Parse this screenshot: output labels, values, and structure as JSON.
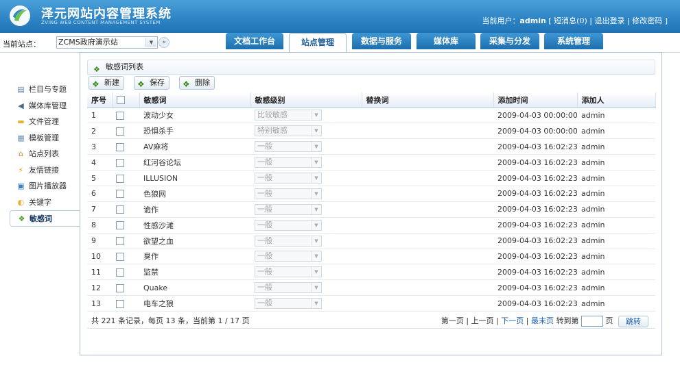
{
  "header": {
    "title": "泽元网站内容管理系统",
    "subtitle": "ZVING WEB CONTENT MANAGEMENT SYSTEM",
    "user_prefix": "当前用户：",
    "user_name": "admin",
    "bracket_open": "[",
    "messages": "短消息(0)",
    "logout": "退出登录",
    "change_password": "修改密码",
    "bracket_close": "]",
    "sep": "|"
  },
  "site": {
    "label": "当前站点：",
    "value": "ZCMS政府演示站",
    "collapse": "«"
  },
  "tabs": [
    {
      "label": "文档工作台"
    },
    {
      "label": "站点管理"
    },
    {
      "label": "数据与服务"
    },
    {
      "label": "媒体库"
    },
    {
      "label": "采集与分发"
    },
    {
      "label": "系统管理"
    }
  ],
  "sidebar": {
    "items": [
      {
        "label": "栏目与专题",
        "icon": "column-icon"
      },
      {
        "label": "媒体库管理",
        "icon": "media-icon"
      },
      {
        "label": "文件管理",
        "icon": "folder-icon"
      },
      {
        "label": "模板管理",
        "icon": "template-icon"
      },
      {
        "label": "站点列表",
        "icon": "home-icon"
      },
      {
        "label": "友情链接",
        "icon": "link-icon"
      },
      {
        "label": "图片播放器",
        "icon": "image-player-icon"
      },
      {
        "label": "关键字",
        "icon": "keyword-icon"
      },
      {
        "label": "敏感词",
        "icon": "sensitive-word-icon"
      }
    ]
  },
  "panel": {
    "title": "敏感词列表",
    "buttons": {
      "new": "新建",
      "save": "保存",
      "delete": "删除"
    }
  },
  "table": {
    "columns": [
      "序号",
      "",
      "敏感词",
      "敏感级别",
      "替换词",
      "添加时间",
      "添加人"
    ],
    "rows": [
      {
        "no": "1",
        "word": "波动少女",
        "level": "比较敏感",
        "replace": "",
        "time": "2009-04-03 00:00:00",
        "user": "admin"
      },
      {
        "no": "2",
        "word": "恐惧杀手",
        "level": "特别敏感",
        "replace": "",
        "time": "2009-04-03 00:00:00",
        "user": "admin"
      },
      {
        "no": "3",
        "word": "AV麻将",
        "level": "一般",
        "replace": "",
        "time": "2009-04-03 16:02:23",
        "user": "admin"
      },
      {
        "no": "4",
        "word": "红河谷论坛",
        "level": "一般",
        "replace": "",
        "time": "2009-04-03 16:02:23",
        "user": "admin"
      },
      {
        "no": "5",
        "word": "ILLUSION",
        "level": "一般",
        "replace": "",
        "time": "2009-04-03 16:02:23",
        "user": "admin"
      },
      {
        "no": "6",
        "word": "色狼网",
        "level": "一般",
        "replace": "",
        "time": "2009-04-03 16:02:23",
        "user": "admin"
      },
      {
        "no": "7",
        "word": "诡作",
        "level": "一般",
        "replace": "",
        "time": "2009-04-03 16:02:23",
        "user": "admin"
      },
      {
        "no": "8",
        "word": "性感沙滩",
        "level": "一般",
        "replace": "",
        "time": "2009-04-03 16:02:23",
        "user": "admin"
      },
      {
        "no": "9",
        "word": "欲望之血",
        "level": "一般",
        "replace": "",
        "time": "2009-04-03 16:02:23",
        "user": "admin"
      },
      {
        "no": "10",
        "word": "臭作",
        "level": "一般",
        "replace": "",
        "time": "2009-04-03 16:02:23",
        "user": "admin"
      },
      {
        "no": "11",
        "word": "监禁",
        "level": "一般",
        "replace": "",
        "time": "2009-04-03 16:02:23",
        "user": "admin"
      },
      {
        "no": "12",
        "word": "Quake",
        "level": "一般",
        "replace": "",
        "time": "2009-04-03 16:02:23",
        "user": "admin"
      },
      {
        "no": "13",
        "word": "电车之狼",
        "level": "一般",
        "replace": "",
        "time": "2009-04-03 16:02:23",
        "user": "admin"
      }
    ]
  },
  "footer": {
    "summary": "共 221 条记录，每页 13 条，当前第 1 / 17 页",
    "first": "第一页",
    "prev": "上一页",
    "next": "下一页",
    "last": "最末页",
    "sep": "|",
    "jump_to": "转到第",
    "page_unit": "页",
    "jump_button": "跳转"
  }
}
